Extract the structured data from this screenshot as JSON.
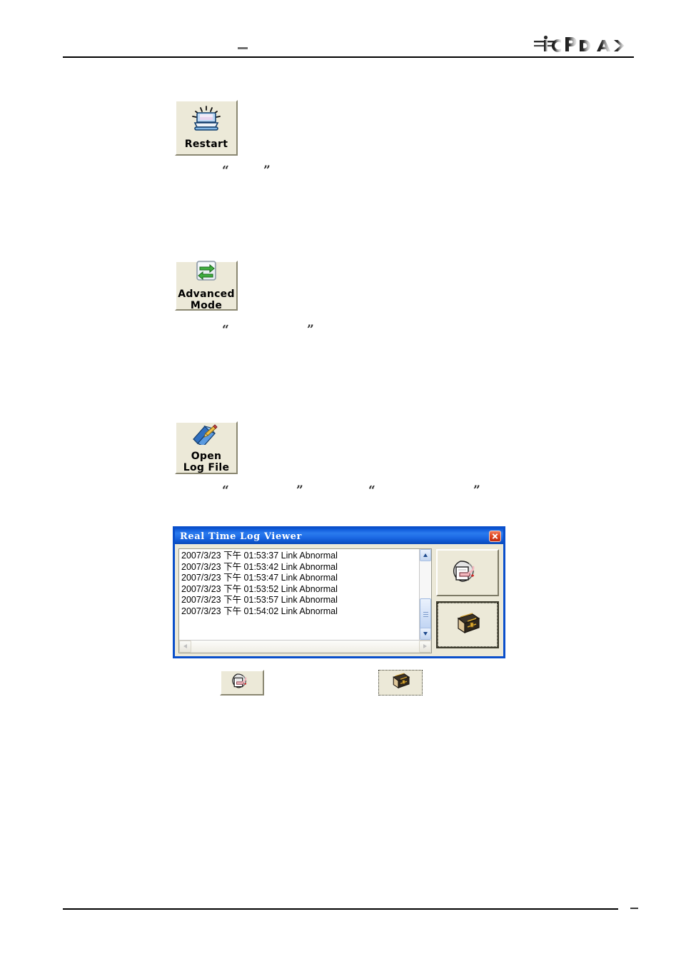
{
  "page": {
    "header": {
      "brand_logo": "icpdas-logo",
      "brand_text": "ICP DAS",
      "divider": "header-rule",
      "center_mark": "–"
    },
    "footer": {
      "divider": "footer-rule",
      "page_mark": "–"
    }
  },
  "buttons": [
    {
      "id": "restart",
      "label": "Restart",
      "icon": "computer-restart-icon"
    },
    {
      "id": "advanced-mode",
      "label": "Advanced\nMode",
      "icon": "exchange-arrows-icon"
    },
    {
      "id": "open-log-file",
      "label": "Open\nLog  File",
      "icon": "book-pencil-icon"
    }
  ],
  "redacted_quotes": [
    {
      "open": "“",
      "close": "”",
      "row": 1,
      "pair": 1
    },
    {
      "open": "“",
      "close": "”",
      "row": 2,
      "pair": 1
    },
    {
      "open": "“",
      "close": "”",
      "row": 3,
      "pair": 1
    },
    {
      "open": "“",
      "close": "”",
      "row": 3,
      "pair": 2
    }
  ],
  "dialog": {
    "title": "Real Time Log Viewer",
    "close_button_label": "×",
    "log_entries": [
      "2007/3/23 下午 01:53:37 Link Abnormal",
      "2007/3/23 下午 01:53:42 Link Abnormal",
      "2007/3/23 下午 01:53:47 Link Abnormal",
      "2007/3/23 下午 01:53:52 Link Abnormal",
      "2007/3/23 下午 01:53:57 Link Abnormal",
      "2007/3/23 下午 01:54:02 Link Abnormal"
    ],
    "scrollbars": {
      "vertical": {
        "enabled": true,
        "thumb_position": "middle"
      },
      "horizontal": {
        "enabled": false
      }
    },
    "side_buttons": [
      {
        "id": "clear-log",
        "icon": "clear-log-icon",
        "focused": false
      },
      {
        "id": "save-log-book",
        "icon": "log-book-icon",
        "focused": true
      }
    ]
  },
  "icon_buttons": [
    {
      "id": "clear-log-standalone",
      "icon": "clear-log-icon",
      "focused": false
    },
    {
      "id": "log-book-standalone",
      "icon": "log-book-icon",
      "focused": true
    }
  ],
  "colors": {
    "dialog_border": "#0A4FCB",
    "titlebar_blue": "#1763E0",
    "close_red": "#E04A24",
    "button_face": "#ECE9D8",
    "log_text": "#000000",
    "scrollbar_blue": "#C3D5F0"
  }
}
